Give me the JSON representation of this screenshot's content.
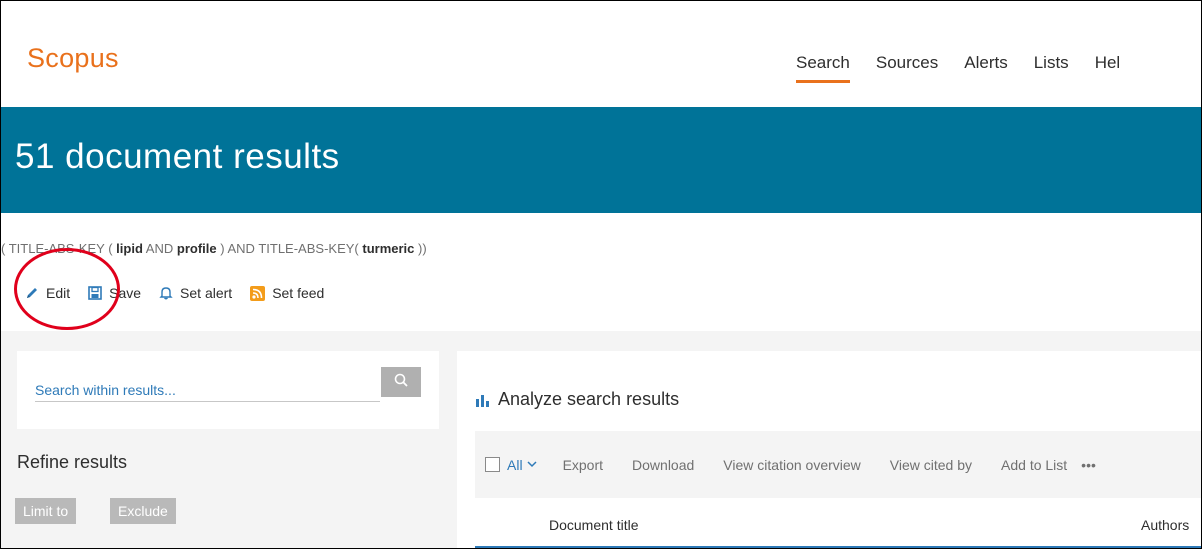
{
  "app": {
    "logo": "Scopus"
  },
  "nav": {
    "items": [
      "Search",
      "Sources",
      "Alerts",
      "Lists",
      "Hel"
    ],
    "active": "Search"
  },
  "banner": {
    "title": "51 document results"
  },
  "query": {
    "open": "(",
    "f1": "TITLE-ABS-KEY",
    "p1open": "(",
    "t1": "lipid",
    "and1": "AND",
    "t2": "profile",
    "p1close": ")",
    "and2": "AND",
    "f2": "TITLE-ABS-KEY",
    "p2open": "(",
    "t3": "turmeric",
    "close": "))"
  },
  "actions": {
    "edit": "Edit",
    "save": "Save",
    "set_alert": "Set alert",
    "set_feed": "Set feed"
  },
  "search_within": {
    "placeholder": "Search within results..."
  },
  "refine": {
    "title": "Refine results",
    "limit_to": "Limit to",
    "exclude": "Exclude"
  },
  "analyze": {
    "label": "Analyze search results"
  },
  "toolbar": {
    "all": "All",
    "export": "Export",
    "download": "Download",
    "view_citation": "View citation overview",
    "view_cited": "View cited by",
    "add_to_list": "Add to List",
    "more": "•••"
  },
  "table": {
    "col_title": "Document title",
    "col_authors": "Authors"
  },
  "colors": {
    "brand_orange": "#e9711c",
    "banner_teal": "#007398",
    "link_blue": "#2e7ab8",
    "annotation_red": "#e0001b",
    "feed_orange": "#f39c1a"
  },
  "icons": {
    "edit": "pencil-icon",
    "save": "floppy-disk-icon",
    "alert": "bell-icon",
    "feed": "rss-icon",
    "search": "search-icon",
    "analyze": "bar-chart-icon",
    "all_dropdown": "chevron-down-icon"
  }
}
